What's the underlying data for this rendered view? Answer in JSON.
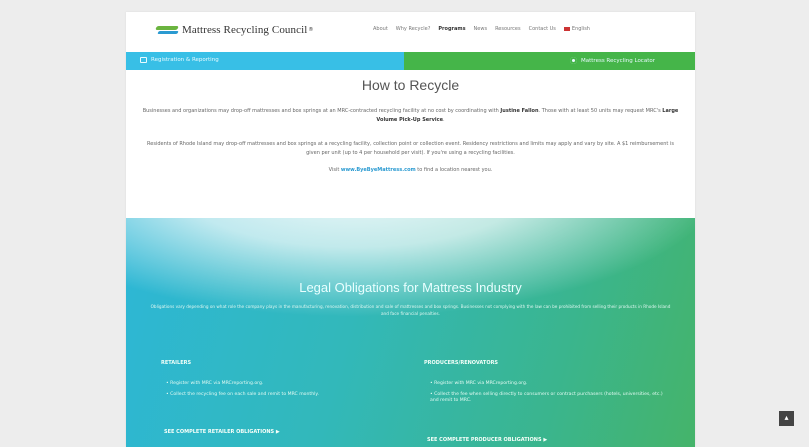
{
  "logo": {
    "text": "Mattress Recycling Council",
    "trademark": "®"
  },
  "nav": {
    "items": [
      {
        "label": "About"
      },
      {
        "label": "Why Recycle?"
      },
      {
        "label": "Programs",
        "active": true
      },
      {
        "label": "News"
      },
      {
        "label": "Resources"
      },
      {
        "label": "Contact Us"
      }
    ],
    "language": "English"
  },
  "bars": {
    "left_label": "Registration & Reporting",
    "right_label": "Mattress Recycling Locator"
  },
  "recycle": {
    "title": "How to Recycle",
    "p1a": "Businesses and organizations may drop-off mattresses and box springs at an MRC-contracted recycling facility at no cost by coordinating with ",
    "p1b": "Justine Fallon",
    "p1c": ". Those with at least 50 units may request MRC's ",
    "p1d": "Large Volume Pick-Up Service",
    "p1e": ".",
    "p2": "Residents of Rhode Island may drop-off mattresses and box springs at a recycling facility, collection point or collection event. Residency restrictions and limits may apply and vary by site. A $1 reimbursement is given per unit (up to 4 per household per visit). If you're using a recycling facilities.",
    "p3a": "Visit ",
    "p3b": "www.ByeByeMattress.com",
    "p3c": " to find a location nearest you."
  },
  "legal": {
    "title": "Legal Obligations for Mattress Industry",
    "subtitle": "Obligations vary depending on what role the company plays in the manufacturing, renovation, distribution and sale of mattresses and box springs. Businesses not complying with the law can be prohibited from selling their products in Rhode Island and face financial penalties.",
    "retailers": {
      "title": "RETAILERS",
      "bullets": [
        "Register with MRC via MRCreporting.org.",
        "Collect the recycling fee on each sale and remit to MRC monthly."
      ],
      "cta": "SEE COMPLETE RETAILER OBLIGATIONS"
    },
    "producers": {
      "title": "PRODUCERS/RENOVATORS",
      "bullets": [
        "Register with MRC via MRCreporting.org.",
        "Collect the fee when selling directly to consumers or contract purchasers (hotels, universities, etc.) and remit to MRC."
      ],
      "cta": "SEE COMPLETE PRODUCER OBLIGATIONS"
    }
  },
  "to_top": "▴"
}
